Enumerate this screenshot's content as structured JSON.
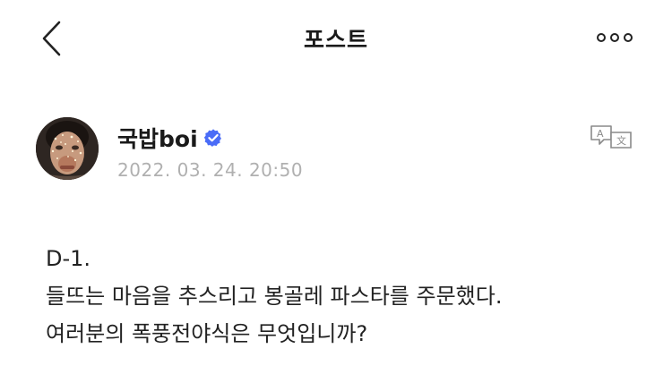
{
  "header": {
    "title": "포스트"
  },
  "author": {
    "name": "국밥boi",
    "verified": true
  },
  "post": {
    "timestamp": "2022. 03. 24. 20:50",
    "lines": [
      "D-1.",
      "들뜨는 마음을 추스리고 봉골레 파스타를 주문했다.",
      "여러분의 폭풍전야식은 무엇입니까?"
    ]
  },
  "icons": {
    "back": "chevron-left-icon",
    "more": "more-horizontal-icon",
    "verified": "verified-badge-icon",
    "translate": "translate-icon"
  },
  "colors": {
    "verified_badge": "#4a6cf7",
    "timestamp": "#b0b0b0",
    "text": "#1a1a1a"
  }
}
